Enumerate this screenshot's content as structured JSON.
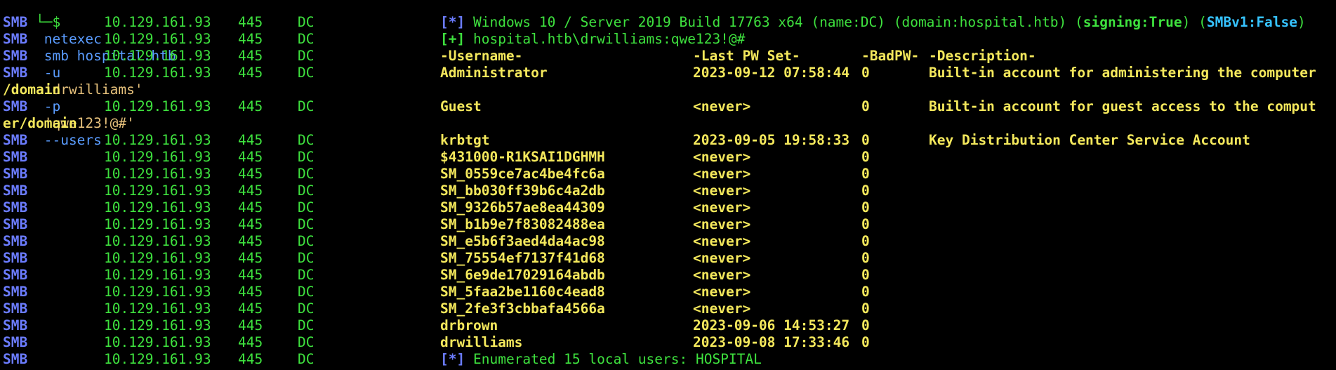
{
  "command": {
    "prompt": "└─$",
    "program": "netexec",
    "args_plain": "smb hospital.htb",
    "u_flag": "-u",
    "user_quoted": "'drwilliams'",
    "p_flag": "-p",
    "pass_quoted": "'qwe123!@#'",
    "users_flag": "--users"
  },
  "row_prefix": {
    "proto": "SMB",
    "ip": "10.129.161.93",
    "port": "445",
    "host": "DC"
  },
  "banner": {
    "tag": "[*]",
    "text": "Windows 10 / Server 2019 Build 17763 x64 (name:DC) (domain:hospital.htb) (",
    "signing": "signing:True",
    "mid": ") (",
    "smbv1": "SMBv1:False",
    "end": ")"
  },
  "auth": {
    "tag": "[+]",
    "text": "hospital.htb\\drwilliams:qwe123!@#"
  },
  "table_header": {
    "username": "-Username-",
    "last_pw_set": "-Last PW Set-",
    "badpw": "-BadPW-",
    "description": "-Description-"
  },
  "users": [
    {
      "username": "Administrator",
      "last_pw_set": "2023-09-12 07:58:44",
      "badpw": "0",
      "description": "Built-in account for administering the computer",
      "wrap": "/domain"
    },
    {
      "username": "Guest",
      "last_pw_set": "<never>",
      "badpw": "0",
      "description": "Built-in account for guest access to the comput",
      "wrap": "er/domain"
    },
    {
      "username": "krbtgt",
      "last_pw_set": "2023-09-05 19:58:33",
      "badpw": "0",
      "description": "Key Distribution Center Service Account",
      "wrap": ""
    },
    {
      "username": "$431000-R1KSAI1DGHMH",
      "last_pw_set": "<never>",
      "badpw": "0",
      "description": "",
      "wrap": ""
    },
    {
      "username": "SM_0559ce7ac4be4fc6a",
      "last_pw_set": "<never>",
      "badpw": "0",
      "description": "",
      "wrap": ""
    },
    {
      "username": "SM_bb030ff39b6c4a2db",
      "last_pw_set": "<never>",
      "badpw": "0",
      "description": "",
      "wrap": ""
    },
    {
      "username": "SM_9326b57ae8ea44309",
      "last_pw_set": "<never>",
      "badpw": "0",
      "description": "",
      "wrap": ""
    },
    {
      "username": "SM_b1b9e7f83082488ea",
      "last_pw_set": "<never>",
      "badpw": "0",
      "description": "",
      "wrap": ""
    },
    {
      "username": "SM_e5b6f3aed4da4ac98",
      "last_pw_set": "<never>",
      "badpw": "0",
      "description": "",
      "wrap": ""
    },
    {
      "username": "SM_75554ef7137f41d68",
      "last_pw_set": "<never>",
      "badpw": "0",
      "description": "",
      "wrap": ""
    },
    {
      "username": "SM_6e9de17029164abdb",
      "last_pw_set": "<never>",
      "badpw": "0",
      "description": "",
      "wrap": ""
    },
    {
      "username": "SM_5faa2be1160c4ead8",
      "last_pw_set": "<never>",
      "badpw": "0",
      "description": "",
      "wrap": ""
    },
    {
      "username": "SM_2fe3f3cbbafa4566a",
      "last_pw_set": "<never>",
      "badpw": "0",
      "description": "",
      "wrap": ""
    },
    {
      "username": "drbrown",
      "last_pw_set": "2023-09-06 14:53:27",
      "badpw": "0",
      "description": "",
      "wrap": ""
    },
    {
      "username": "drwilliams",
      "last_pw_set": "2023-09-08 17:33:46",
      "badpw": "0",
      "description": "",
      "wrap": ""
    }
  ],
  "summary": {
    "tag": "[*]",
    "text": "Enumerated 15 local users: HOSPITAL"
  }
}
